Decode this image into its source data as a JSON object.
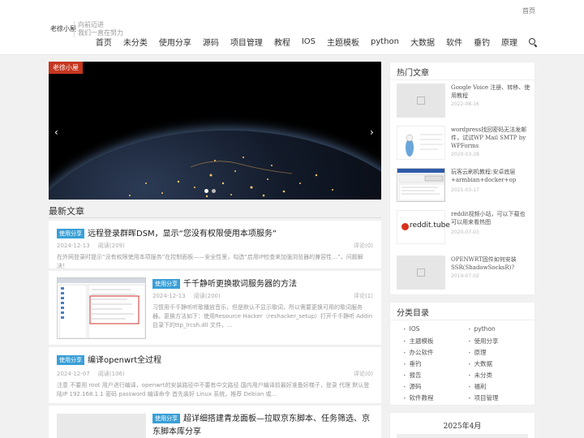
{
  "header": {
    "top_link": "首页",
    "logo": "老徐小屋",
    "slogan_line1": "向前迈进",
    "slogan_line2": "我们一直在努力",
    "nav": [
      "首页",
      "未分类",
      "使用分享",
      "源码",
      "项目管理",
      "教程",
      "IOS",
      "主题模板",
      "python",
      "大数据",
      "软件",
      "垂钓",
      "原理"
    ]
  },
  "slider": {
    "badge": "老徐小屋",
    "prev": "‹",
    "next": "›"
  },
  "latest": {
    "title": "最新文章",
    "articles": [
      {
        "tag": "使用分享",
        "title": "远程登录群晖DSM，显示“您没有权限使用本项服务”",
        "date": "2024-12-13",
        "views": "阅读(209)",
        "comments": "评论(0)",
        "excerpt": "在外网登录时提示“没有权限使用本项服务”在控制面板——安全性里，勾选“启用IP检查来加强浏览器的兼容性…”，问题解决！"
      },
      {
        "tag": "使用分享",
        "title": "千千静听更换歌词服务器的方法",
        "date": "2024-12-13",
        "views": "阅读(200)",
        "comments": "评论(1)",
        "excerpt": "习惯用千千静听听歌播放音乐，但是默认不显示歌词，所以需要更换可用的歌词服务器。更换方法如下：使用Resource Hacker（reshacker_setup）打开千千静听 Addin 目录下的ttp_lrcsh.dll 文件，..."
      },
      {
        "tag": "使用分享",
        "title": "编译openwrt全过程",
        "date": "2024-12-07",
        "views": "阅读(106)",
        "comments": "评论(0)",
        "excerpt": "注意 不要用 root 用户进行编译，openwrt的安装路径中不要有中文路径 国内用户编译前最好准备好梯子，登录 代理 默认登陆IP 192.168.1.1 密码 password 编译命令 首先装好 Linux 系统，推荐 Debian 或..."
      },
      {
        "tag": "使用分享",
        "title": "超详细搭建青龙面板—拉取京东脚本、任务筛选、京东脚本库分享"
      }
    ]
  },
  "sidebar": {
    "hot_title": "热门文章",
    "hot": [
      {
        "title": "Google Voice 注册、转移、使用教程",
        "date": "2022-08-16"
      },
      {
        "title": "wordpress找回密码无法发邮件，试试WP Mail SMTP by WPForms",
        "date": "2020-03-28"
      },
      {
        "title": "玩客云刷机教程:安卓底层+armbian+docker+op",
        "date": "2021-03-17"
      },
      {
        "title": "reddit视频小站，可以下载也可以用来看热图",
        "date": "2020-07-03"
      },
      {
        "title": "OPENWRT固件如何安装SSR(ShadowSocksR)?",
        "date": "2019-07-02"
      }
    ],
    "hot_thumb_text": "reddit.tube",
    "cat_title": "分类目录",
    "categories": [
      "IOS",
      "python",
      "主题模板",
      "使用分享",
      "办公软件",
      "原理",
      "垂钓",
      "大数据",
      "报告",
      "未分类",
      "源码",
      "福利",
      "软件教程",
      "项目管理"
    ],
    "calendar_title": "2025年4月"
  }
}
